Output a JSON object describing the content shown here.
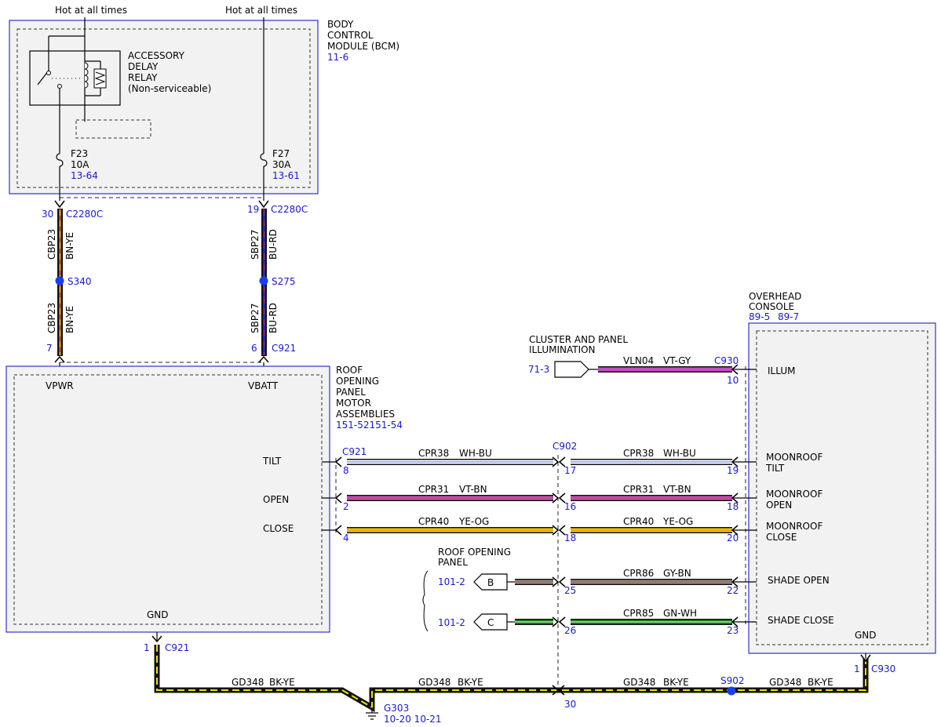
{
  "hot_labels": [
    "Hot at all times",
    "Hot at all times"
  ],
  "bcm": {
    "lines": [
      "BODY",
      "CONTROL",
      "MODULE (BCM)"
    ],
    "ref": "11-6"
  },
  "relay": {
    "lines": [
      "ACCESSORY",
      "DELAY",
      "RELAY",
      "(Non-serviceable)"
    ]
  },
  "fuses": [
    {
      "name": "F23",
      "rating": "10A",
      "ref": "13-64"
    },
    {
      "name": "F27",
      "rating": "30A",
      "ref": "13-61"
    }
  ],
  "left_feed": {
    "top_pin": "30",
    "top_conn": "C2280C",
    "upper_circuit": "CBP23",
    "upper_color": "BN-YE",
    "splice": "S340",
    "lower_circuit": "CBP23",
    "lower_color": "BN-YE",
    "bottom_pin": "7",
    "colors": [
      "#a0522d",
      "#e8c800"
    ]
  },
  "right_feed": {
    "top_pin": "19",
    "top_conn": "C2280C",
    "upper_circuit": "SBP27",
    "upper_color": "BU-RD",
    "splice": "S275",
    "lower_circuit": "SBP27",
    "lower_color": "BU-RD",
    "bottom_pin": "6",
    "bottom_conn": "C921",
    "colors": [
      "#2222cc",
      "#cc2222"
    ]
  },
  "motor": {
    "lines": [
      "ROOF",
      "OPENING",
      "PANEL",
      "MOTOR",
      "ASSEMBLIES"
    ],
    "ref": "151-52151-54",
    "pins": [
      "VPWR",
      "VBATT",
      "TILT",
      "OPEN",
      "CLOSE",
      "GND"
    ]
  },
  "overhead": {
    "lines": [
      "OVERHEAD",
      "CONSOLE"
    ],
    "refs": [
      "89-5",
      "89-7"
    ],
    "pins": [
      {
        "lines": [
          "ILLUM"
        ]
      },
      {
        "lines": [
          "MOONROOF",
          "TILT"
        ]
      },
      {
        "lines": [
          "MOONROOF",
          "OPEN"
        ]
      },
      {
        "lines": [
          "MOONROOF",
          "CLOSE"
        ]
      },
      {
        "lines": [
          "SHADE OPEN"
        ]
      },
      {
        "lines": [
          "SHADE CLOSE"
        ]
      },
      {
        "lines": [
          "GND"
        ]
      }
    ]
  },
  "cluster": {
    "lines": [
      "CLUSTER AND PANEL",
      "ILLUMINATION"
    ],
    "ref": "71-3",
    "circuit": "VLN04",
    "color": "VT-GY",
    "conn": "C930",
    "pin": "10",
    "colors": [
      "#cc44cc",
      "#888888"
    ]
  },
  "roof_panel": {
    "lines": [
      "ROOF OPENING",
      "PANEL"
    ],
    "refs": [
      "101-2",
      "101-2"
    ],
    "letters": [
      "B",
      "C"
    ]
  },
  "conn_labels": {
    "c921": "C921",
    "c902": "C902",
    "c930": "C930"
  },
  "wires": [
    {
      "circuit": "CPR38",
      "color": "WH-BU",
      "left_pin": "8",
      "mid_pin": "17",
      "right_pin": "19",
      "colors": [
        "#ffffff",
        "#4a6cd4"
      ]
    },
    {
      "circuit": "CPR31",
      "color": "VT-BN",
      "left_pin": "2",
      "mid_pin": "16",
      "right_pin": "18",
      "colors": [
        "#d050c8",
        "#a0522d"
      ]
    },
    {
      "circuit": "CPR40",
      "color": "YE-OG",
      "left_pin": "4",
      "mid_pin": "18",
      "right_pin": "20",
      "colors": [
        "#f0d000",
        "#f08000"
      ]
    },
    {
      "circuit": "CPR86",
      "color": "GY-BN",
      "mid_pin": "25",
      "right_pin": "22",
      "colors": [
        "#909090",
        "#a0522d"
      ]
    },
    {
      "circuit": "CPR85",
      "color": "GN-WH",
      "mid_pin": "26",
      "right_pin": "23",
      "colors": [
        "#1a8a1a",
        "#ffffff"
      ]
    }
  ],
  "ground": {
    "motor_pin": "1",
    "motor_conn": "C921",
    "circuit": "GD348",
    "color": "BK-YE",
    "ground_point": "G303",
    "ground_refs": "10-20 10-21",
    "c902_pin": "30",
    "splice": "S902",
    "console_pin": "1",
    "console_conn": "C930",
    "colors": [
      "#111111",
      "#f0e000"
    ]
  }
}
